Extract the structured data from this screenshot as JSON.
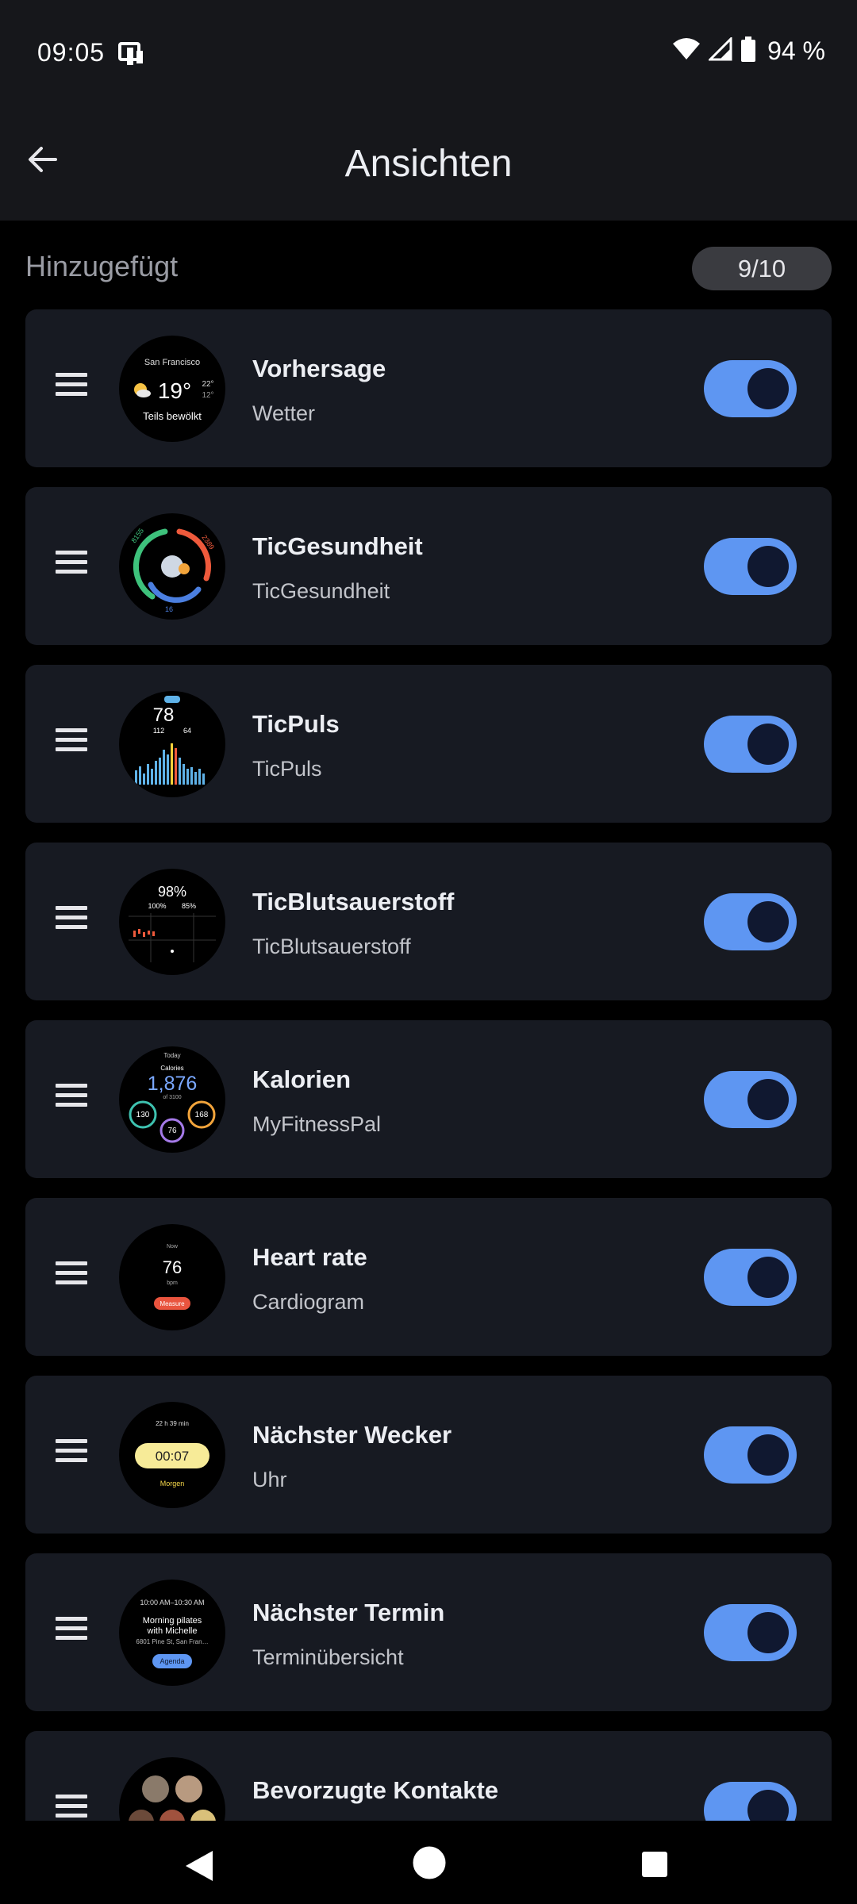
{
  "status": {
    "time": "09:05",
    "battery": "94 %"
  },
  "appbar": {
    "title": "Ansichten"
  },
  "section": {
    "header": "Hinzugefügt",
    "count": "9/10"
  },
  "tiles": [
    {
      "title": "Vorhersage",
      "subtitle": "Wetter",
      "enabled": true,
      "preview": {
        "city": "San Francisco",
        "temp": "19°",
        "high": "22°",
        "low": "12°",
        "condition": "Teils bewölkt"
      }
    },
    {
      "title": "TicGesundheit",
      "subtitle": "TicGesundheit",
      "enabled": true,
      "preview": {
        "steps": "8155",
        "kcal": "2389",
        "mins": "16"
      }
    },
    {
      "title": "TicPuls",
      "subtitle": "TicPuls",
      "enabled": true,
      "preview": {
        "bpm": "78",
        "max": "112",
        "min": "64"
      }
    },
    {
      "title": "TicBlutsauerstoff",
      "subtitle": "TicBlutsauerstoff",
      "enabled": true,
      "preview": {
        "value": "98%",
        "max": "100%",
        "min": "85%"
      }
    },
    {
      "title": "Kalorien",
      "subtitle": "MyFitnessPal",
      "enabled": true,
      "preview": {
        "day": "Today",
        "label": "Calories",
        "value": "1,876",
        "goal": "of 3100",
        "carbs": "130",
        "fat": "76",
        "protein": "168"
      }
    },
    {
      "title": "Heart rate",
      "subtitle": "Cardiogram",
      "enabled": true,
      "preview": {
        "time": "Now",
        "value": "76",
        "unit": "bpm",
        "button": "Measure"
      }
    },
    {
      "title": "Nächster Wecker",
      "subtitle": "Uhr",
      "enabled": true,
      "preview": {
        "remaining": "22 h 39 min",
        "time": "00:07",
        "label": "Morgen"
      }
    },
    {
      "title": "Nächster Termin",
      "subtitle": "Terminübersicht",
      "enabled": true,
      "preview": {
        "time": "10:00 AM–10:30 AM",
        "event1": "Morning pilates",
        "event2": "with Michelle",
        "place": "6801 Pine St, San Fran…",
        "button": "Agenda"
      }
    },
    {
      "title": "Bevorzugte Kontakte",
      "subtitle": "",
      "enabled": true,
      "preview": {}
    }
  ],
  "icons": {
    "back": "arrow-left-icon",
    "drag": "drag-handle-icon",
    "wifi": "wifi-icon",
    "signal": "signal-icon",
    "battery": "battery-icon",
    "notification": "notification-icon"
  },
  "colors": {
    "accent": "#5e96f2",
    "card": "#171a22",
    "appbar": "#16171b"
  }
}
